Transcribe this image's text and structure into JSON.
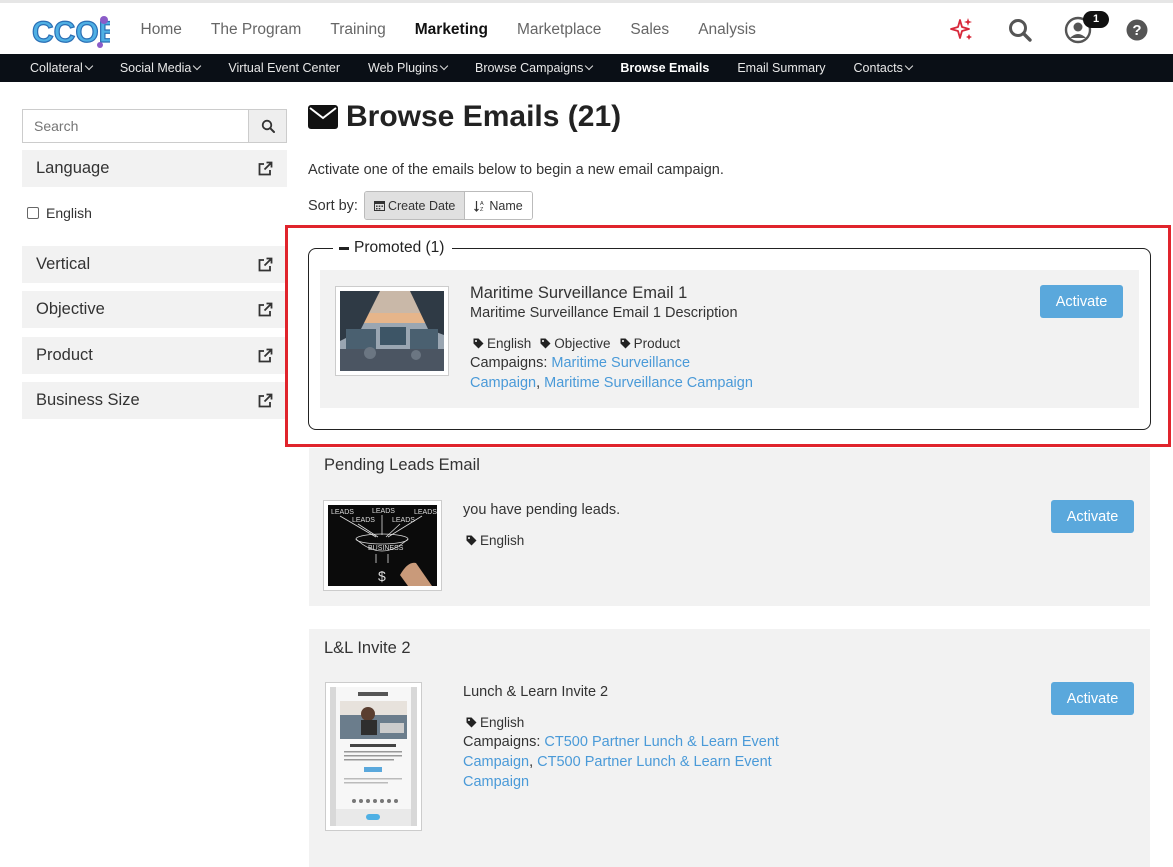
{
  "brand": {
    "logo_text": "CCOE"
  },
  "main_nav": {
    "items": [
      {
        "label": "Home"
      },
      {
        "label": "The Program"
      },
      {
        "label": "Training"
      },
      {
        "label": "Marketing"
      },
      {
        "label": "Marketplace"
      },
      {
        "label": "Sales"
      },
      {
        "label": "Analysis"
      }
    ],
    "active": "Marketing"
  },
  "header_icons": {
    "notifications_count": "1"
  },
  "sub_nav": {
    "items": [
      {
        "label": "Collateral"
      },
      {
        "label": "Social Media"
      },
      {
        "label": "Virtual Event Center"
      },
      {
        "label": "Web Plugins"
      },
      {
        "label": "Browse Campaigns"
      },
      {
        "label": "Browse Emails"
      },
      {
        "label": "Email Summary"
      },
      {
        "label": "Contacts"
      }
    ],
    "active": "Browse Emails"
  },
  "sidebar": {
    "search_placeholder": "Search",
    "facets": [
      {
        "label": "Language"
      },
      {
        "label": "Vertical"
      },
      {
        "label": "Objective"
      },
      {
        "label": "Product"
      },
      {
        "label": "Business Size"
      }
    ],
    "language_options": [
      {
        "label": "English",
        "checked": false
      }
    ]
  },
  "page": {
    "title": "Browse Emails (21)",
    "intro": "Activate one of the emails below to begin a new email campaign.",
    "sort_label": "Sort by:",
    "sort_options": [
      {
        "label": "Create Date"
      },
      {
        "label": "Name"
      }
    ],
    "sort_active": "Create Date"
  },
  "promoted": {
    "legend": "Promoted (1)",
    "email": {
      "title": "Maritime Surveillance Email 1",
      "description": "Maritime Surveillance Email 1 Description",
      "tags": [
        "English",
        "Objective",
        "Product"
      ],
      "campaigns_label": "Campaigns:",
      "campaign_1_line1": "Maritime Surveillance",
      "campaign_1_line2": "Campaign",
      "separator": ",",
      "campaign_2": "Maritime Surveillance Campaign",
      "activate_label": "Activate"
    }
  },
  "emails": [
    {
      "header": "Pending Leads Email",
      "description": "you have pending leads.",
      "tags": [
        "English"
      ],
      "activate_label": "Activate",
      "thumb_text": {
        "leads": "LEADS",
        "business": "BUSINESS",
        "dollar": "$"
      }
    },
    {
      "header": "L&L Invite 2",
      "description": "Lunch & Learn Invite 2",
      "tags": [
        "English"
      ],
      "campaigns_label": "Campaigns:",
      "campaign_1_line1": "CT500 Partner Lunch & Learn Event",
      "campaign_1_line2": "Campaign",
      "separator": ",",
      "campaign_2_line1": "CT500 Partner Lunch & Learn Event",
      "campaign_2_line2": "Campaign",
      "activate_label": "Activate"
    }
  ],
  "colors": {
    "accent": "#5aa8dc",
    "link": "#4a9ad8",
    "highlight": "#e0242c",
    "subnav_bg": "#0a0f16"
  }
}
